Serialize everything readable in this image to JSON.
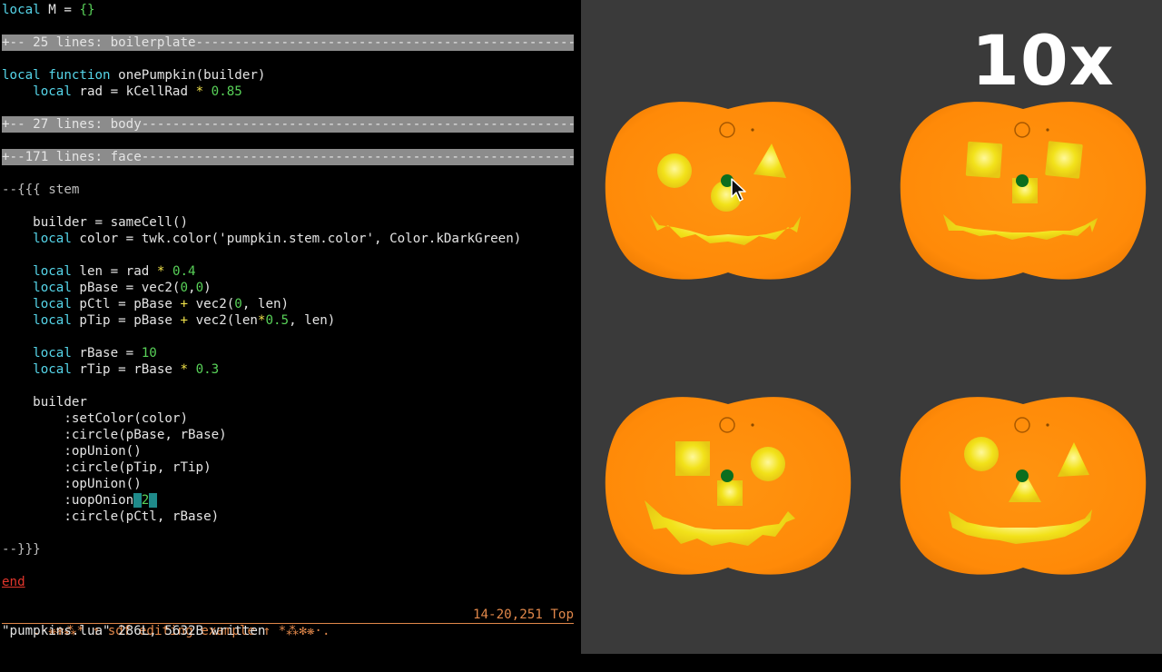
{
  "editor": {
    "lines": {
      "l1_kw": "local",
      "l1_rest": " M = ",
      "l1_brace": "{}",
      "fold1": "+-- 25 lines: boilerplate----------------------------------------------------",
      "l3_kw1": "local",
      "l3_kw2": "function",
      "l3_rest": " onePumpkin(builder)",
      "l4_kw": "local",
      "l4_rest": " rad = kCellRad ",
      "l4_op": "*",
      "l4_num": "0.85",
      "fold2": "+-- 27 lines: body-----------------------------------------------------------",
      "fold3": "+--171 lines: face-----------------------------------------------------------",
      "l7": "--{{{ stem",
      "l8": "builder = sameCell()",
      "l9_kw": "local",
      "l9_rest": " color = twk.color('pumpkin.stem.color', Color.kDarkGreen)",
      "l10_kw": "local",
      "l10_rest": " len = rad ",
      "l10_op": "*",
      "l10_num": "0.4",
      "l11_kw": "local",
      "l11_rest": " pBase = vec2(",
      "l11_n1": "0",
      "l11_c": ",",
      "l11_n2": "0",
      "l11_end": ")",
      "l12_kw": "local",
      "l12_rest": " pCtl = pBase ",
      "l12_op": "+",
      "l12_mid": " vec2(",
      "l12_n1": "0",
      "l12_end": ", len)",
      "l13_kw": "local",
      "l13_rest": " pTip = pBase ",
      "l13_op": "+",
      "l13_mid": " vec2(len",
      "l13_op2": "*",
      "l13_num": "0.5",
      "l13_end": ", len)",
      "l14_kw": "local",
      "l14_rest": " rBase = ",
      "l14_num": "10",
      "l15_kw": "local",
      "l15_rest": " rTip = rBase ",
      "l15_op": "*",
      "l15_num": "0.3",
      "l16": "builder",
      "l17": ":setColor(color)",
      "l18": ":circle(pBase, rBase)",
      "l19": ":opUnion()",
      "l20": ":circle(pTip, rTip)",
      "l21": ":opUnion()",
      "l22_a": ":uopOnion",
      "l22_cursor1": " ",
      "l22_num": "2",
      "l22_cursor2": " ",
      "l23": ":circle(pCtl, rBase)",
      "l24": "--}}}",
      "l25": "end"
    },
    "statusline": {
      "left": ".·❋✻⁂* ↑ sdf editing example ↑ *⁂✻❋·.",
      "right": "14-20,251 Top"
    },
    "cmdline": "\"pumpkins.lua\" 286L, 5632B written"
  },
  "viewer": {
    "speed_label": "10x",
    "colors": {
      "pumpkin": "#ff8c0a",
      "face": "#f2e21a",
      "stem": "#0c6e1e",
      "background": "#3a3a3a"
    },
    "pumpkins": [
      {
        "eyes": "circle-and-triangle",
        "nose": "circle"
      },
      {
        "eyes": "square-and-square",
        "nose": "square"
      },
      {
        "eyes": "square-and-circle",
        "nose": "square"
      },
      {
        "eyes": "circle-and-triangle",
        "nose": "triangle"
      }
    ],
    "cursor_icon": "mouse-pointer-icon"
  }
}
